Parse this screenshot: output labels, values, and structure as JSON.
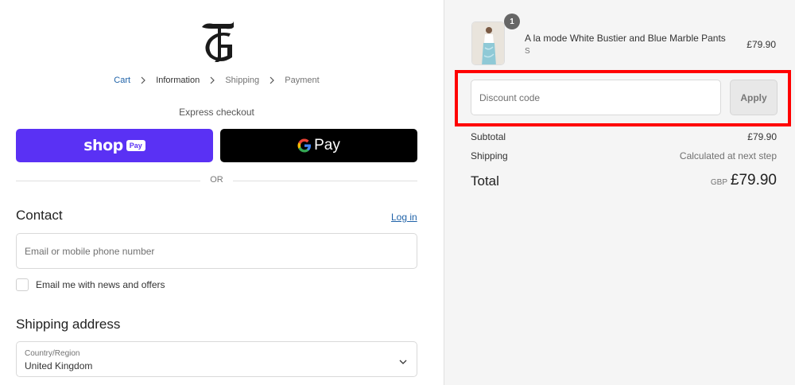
{
  "breadcrumb": {
    "cart": "Cart",
    "information": "Information",
    "shipping": "Shipping",
    "payment": "Payment"
  },
  "express": {
    "label": "Express checkout",
    "shop_pay_text": "shop",
    "shop_pay_badge": "Pay",
    "gpay_text": "Pay"
  },
  "divider": {
    "or": "OR"
  },
  "contact": {
    "title": "Contact",
    "login": "Log in",
    "email_placeholder": "Email or mobile phone number",
    "newsletter_label": "Email me with news and offers"
  },
  "shipping_address": {
    "title": "Shipping address",
    "country_label": "Country/Region",
    "country_value": "United Kingdom"
  },
  "order": {
    "item": {
      "quantity": "1",
      "name": "A la mode White Bustier and Blue Marble Pants",
      "variant": "S",
      "price": "£79.90"
    },
    "discount_placeholder": "Discount code",
    "apply_label": "Apply",
    "subtotal_label": "Subtotal",
    "subtotal_value": "£79.90",
    "shipping_label": "Shipping",
    "shipping_value": "Calculated at next step",
    "total_label": "Total",
    "total_currency": "GBP",
    "total_value": "£79.90"
  },
  "colors": {
    "shop_pay": "#5a31f4",
    "link": "#1f62a8",
    "highlight": "#ff0000"
  }
}
